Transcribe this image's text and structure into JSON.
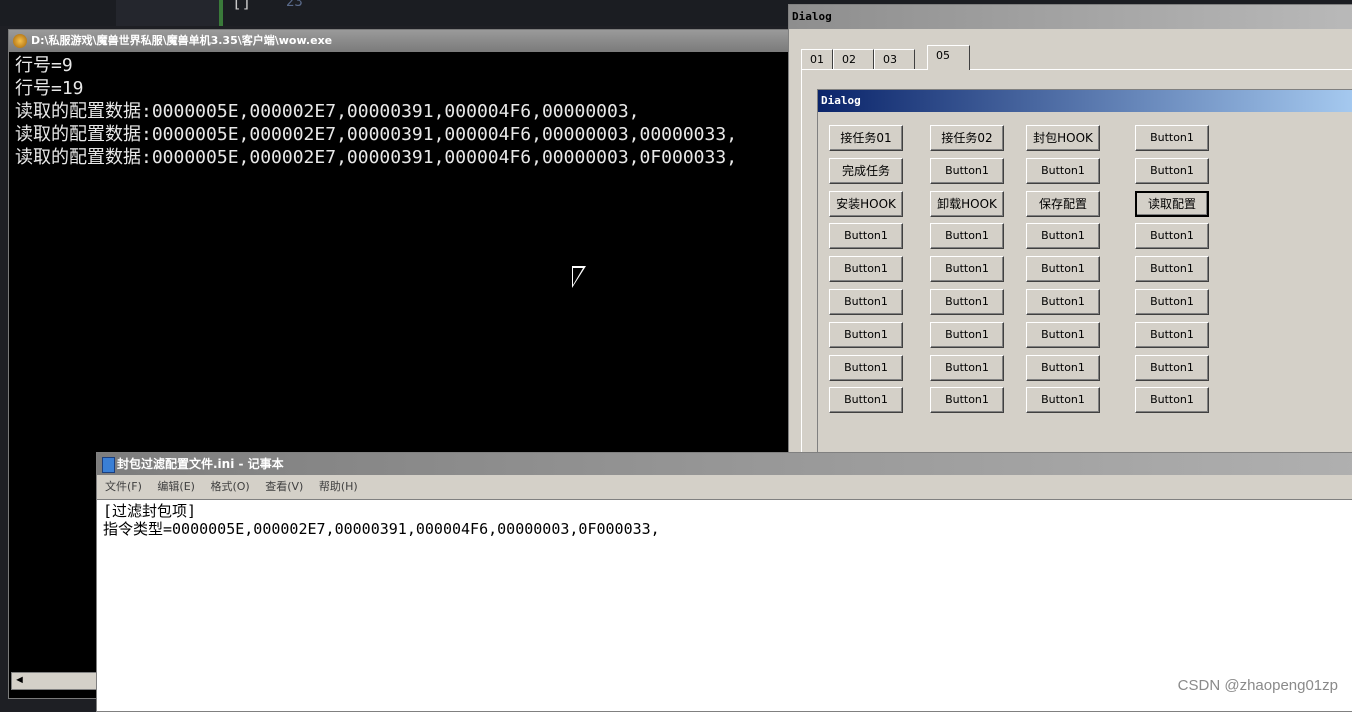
{
  "editor": {
    "line_number": "23",
    "code_text": "[]"
  },
  "console": {
    "title": "D:\\私服游戏\\魔兽世界私服\\魔兽单机3.35\\客户端\\wow.exe",
    "lines": [
      "行号=9",
      "行号=19",
      "读取的配置数据:0000005E,000002E7,00000391,000004F6,00000003,",
      "读取的配置数据:0000005E,000002E7,00000391,000004F6,00000003,00000033,",
      "读取的配置数据:0000005E,000002E7,00000391,000004F6,00000003,0F000033,"
    ],
    "scroll_arrow": "◄"
  },
  "dialog": {
    "title": "Dialog",
    "tabs": [
      "01",
      "02",
      "03",
      "05"
    ],
    "active_tab": "05",
    "inner_title": "Dialog",
    "buttons": [
      [
        "接任务01",
        "接任务02",
        "封包HOOK",
        "Button1"
      ],
      [
        "完成任务",
        "Button1",
        "Button1",
        "Button1"
      ],
      [
        "安装HOOK",
        "卸载HOOK",
        "保存配置",
        "读取配置"
      ],
      [
        "Button1",
        "Button1",
        "Button1",
        "Button1"
      ],
      [
        "Button1",
        "Button1",
        "Button1",
        "Button1"
      ],
      [
        "Button1",
        "Button1",
        "Button1",
        "Button1"
      ],
      [
        "Button1",
        "Button1",
        "Button1",
        "Button1"
      ],
      [
        "Button1",
        "Button1",
        "Button1",
        "Button1"
      ],
      [
        "Button1",
        "Button1",
        "Button1",
        "Button1"
      ]
    ]
  },
  "notepad": {
    "title": "封包过滤配置文件.ini - 记事本",
    "menu": [
      "文件(F)",
      "编辑(E)",
      "格式(O)",
      "查看(V)",
      "帮助(H)"
    ],
    "content": [
      "[过滤封包项]",
      "指令类型=0000005E,000002E7,00000391,000004F6,00000003,0F000033,"
    ]
  },
  "watermark": "CSDN @zhaopeng01zp"
}
